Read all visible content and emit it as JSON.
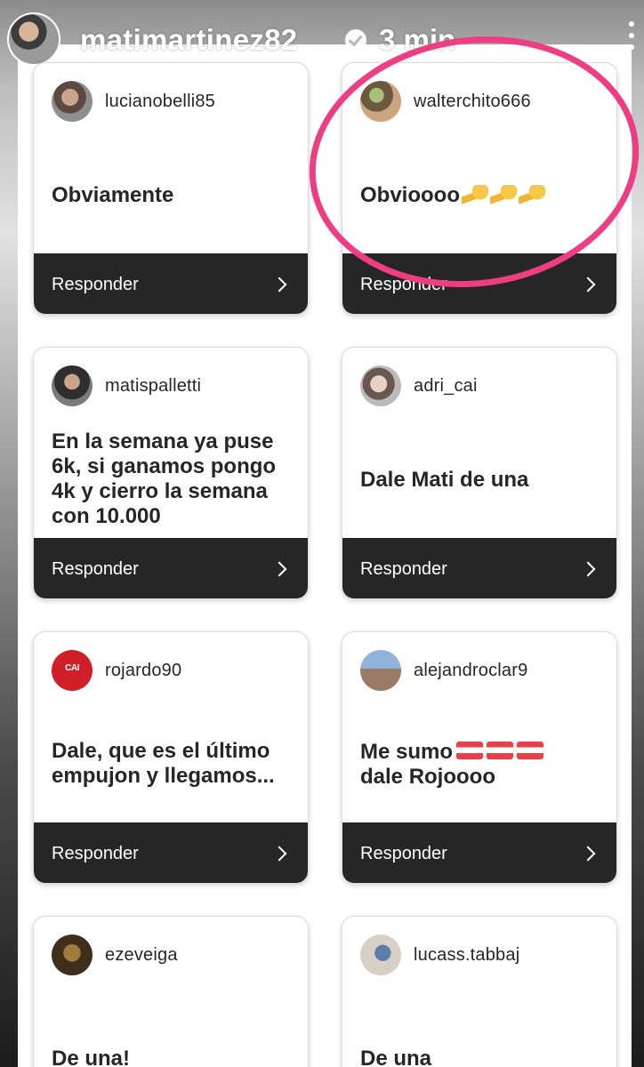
{
  "story": {
    "username": "matimartinez82",
    "time": "3 min"
  },
  "cards": [
    {
      "username": "lucianobelli85",
      "text": "Obviamente",
      "action": "Responder"
    },
    {
      "username": "walterchito666",
      "text": "Obvioooo",
      "emoji": [
        "flexed-biceps",
        "flexed-biceps",
        "flexed-biceps"
      ],
      "action": "Responder"
    },
    {
      "username": "matispalletti",
      "text": "En la semana ya puse 6k, si ganamos pongo 4k y cierro la semana con 10.000",
      "action": "Responder"
    },
    {
      "username": "adri_cai",
      "text": "Dale Mati de una",
      "action": "Responder"
    },
    {
      "username": "rojardo90",
      "text": "Dale, que es el último empujon y llegamos...",
      "action": "Responder"
    },
    {
      "username": "alejandroclar9",
      "text": "Me sumo",
      "text2": "dale Rojoooo",
      "emoji": [
        "flag-austria",
        "flag-austria",
        "flag-austria"
      ],
      "action": "Responder"
    },
    {
      "username": "ezeveiga",
      "text": "De una!"
    },
    {
      "username": "lucass.tabbaj",
      "text": "De una"
    }
  ],
  "colors": {
    "footer": "#262626",
    "highlight": "#ee3d82"
  }
}
